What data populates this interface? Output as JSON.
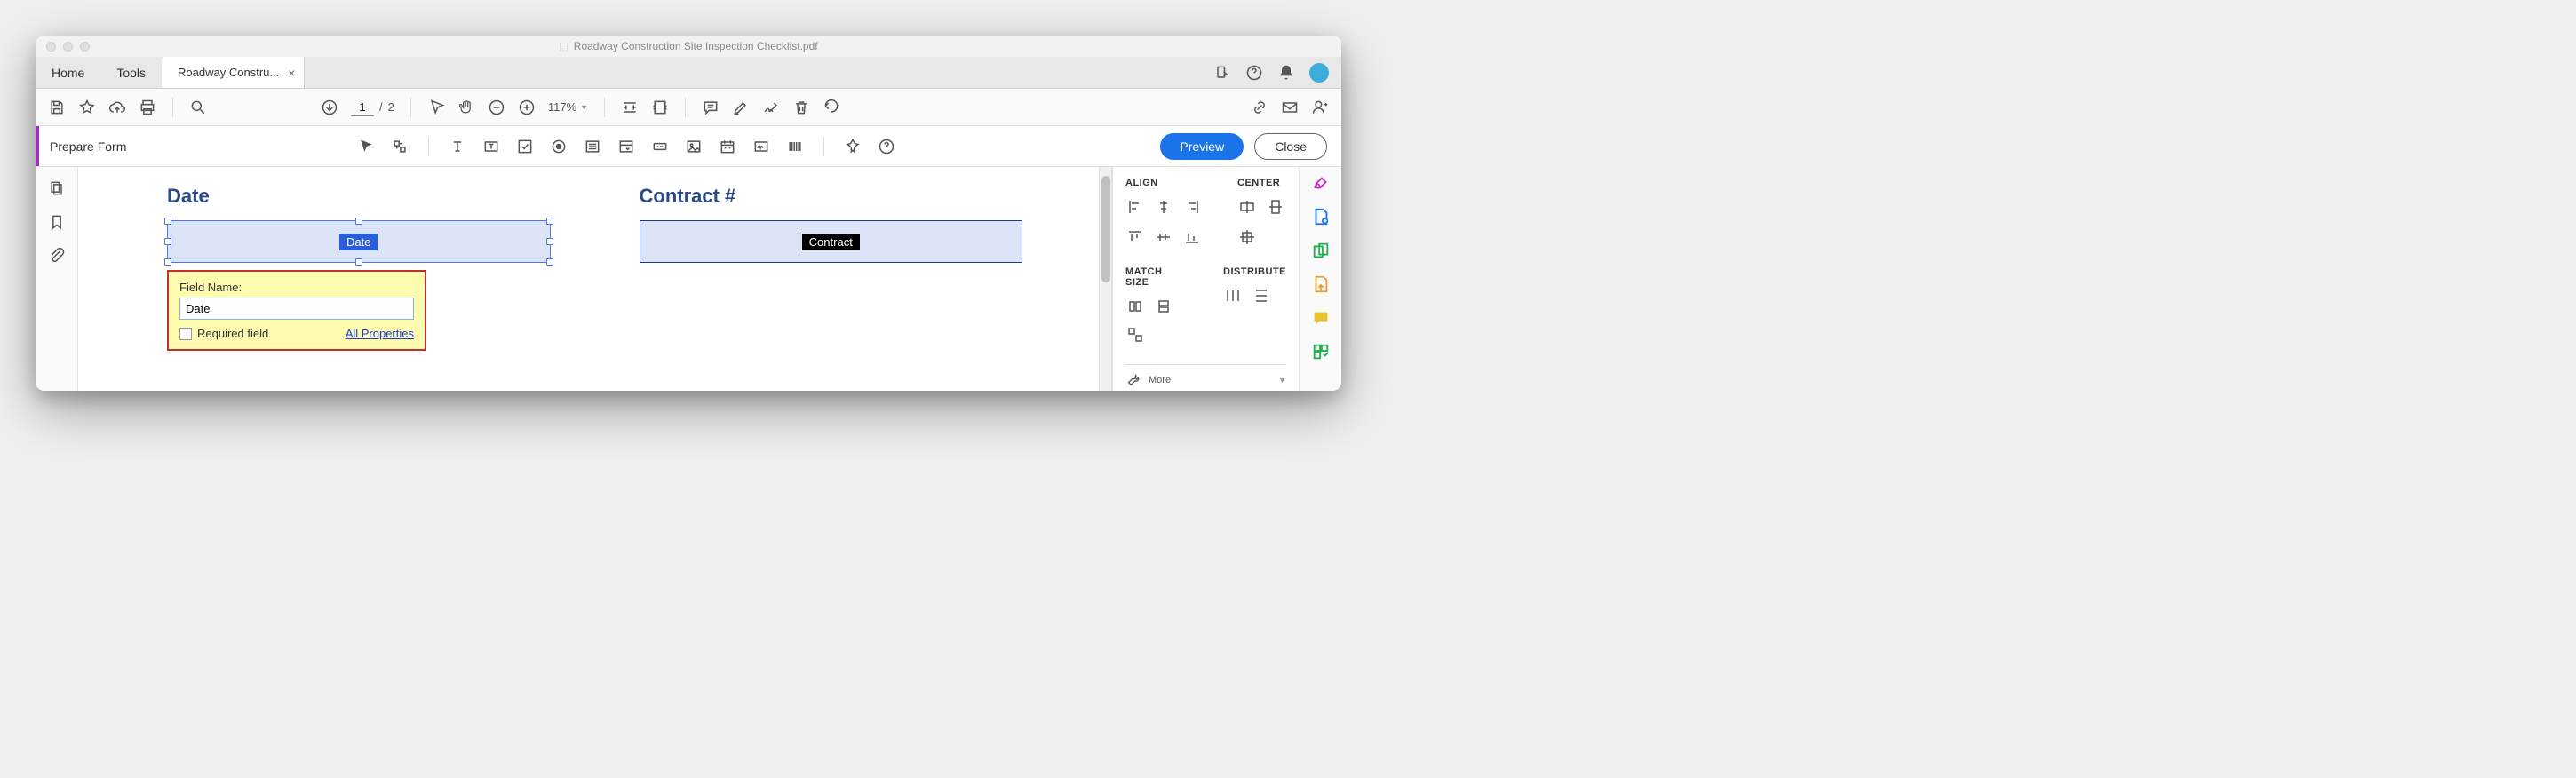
{
  "window": {
    "title": "Roadway Construction Site Inspection Checklist.pdf"
  },
  "tabs": {
    "home": "Home",
    "tools": "Tools",
    "document": "Roadway Constru..."
  },
  "toolbar": {
    "page_current": "1",
    "page_sep": "/",
    "page_total": "2",
    "zoom": "117%"
  },
  "form_toolbar": {
    "title": "Prepare Form",
    "preview": "Preview",
    "close": "Close"
  },
  "canvas": {
    "fields": [
      {
        "label": "Date",
        "tag": "Date",
        "selected": true
      },
      {
        "label": "Contract #",
        "tag": "Contract",
        "selected": false
      }
    ]
  },
  "popup": {
    "label": "Field Name:",
    "value": "Date",
    "required": "Required field",
    "all_props": "All Properties"
  },
  "panel": {
    "align": "ALIGN",
    "center": "CENTER",
    "match": "MATCH SIZE",
    "distribute": "DISTRIBUTE",
    "more": "More"
  }
}
